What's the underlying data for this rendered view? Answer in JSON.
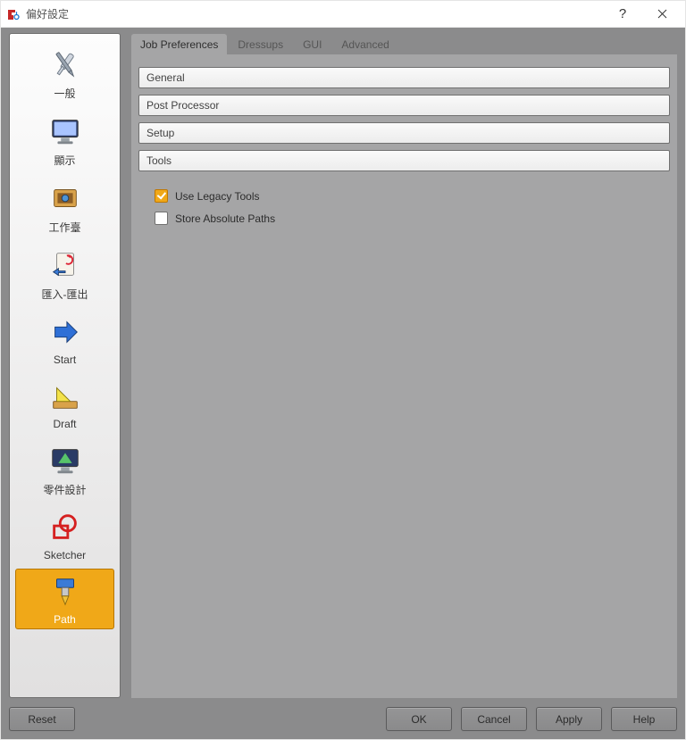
{
  "window": {
    "title": "偏好設定"
  },
  "sidebar": {
    "items": [
      {
        "label": "一般",
        "icon": "wrench-screwdriver-icon",
        "selected": false
      },
      {
        "label": "顯示",
        "icon": "monitor-icon",
        "selected": false
      },
      {
        "label": "工作臺",
        "icon": "workbench-box-icon",
        "selected": false
      },
      {
        "label": "匯入-匯出",
        "icon": "import-export-icon",
        "selected": false
      },
      {
        "label": "Start",
        "icon": "arrow-right-icon",
        "selected": false
      },
      {
        "label": "Draft",
        "icon": "draft-triangle-icon",
        "selected": false
      },
      {
        "label": "零件設計",
        "icon": "part-design-icon",
        "selected": false
      },
      {
        "label": "Sketcher",
        "icon": "sketcher-icon",
        "selected": false
      },
      {
        "label": "Path",
        "icon": "path-drill-icon",
        "selected": true
      }
    ]
  },
  "tabs": [
    {
      "label": "Job Preferences",
      "active": true
    },
    {
      "label": "Dressups",
      "active": false
    },
    {
      "label": "GUI",
      "active": false
    },
    {
      "label": "Advanced",
      "active": false
    }
  ],
  "sections": [
    {
      "label": "General"
    },
    {
      "label": "Post Processor"
    },
    {
      "label": "Setup"
    },
    {
      "label": "Tools"
    }
  ],
  "options": {
    "use_legacy_tools": {
      "label": "Use Legacy Tools",
      "checked": true
    },
    "store_absolute_paths": {
      "label": "Store Absolute Paths",
      "checked": false
    }
  },
  "buttons": {
    "reset": "Reset",
    "ok": "OK",
    "cancel": "Cancel",
    "apply": "Apply",
    "help": "Help"
  }
}
